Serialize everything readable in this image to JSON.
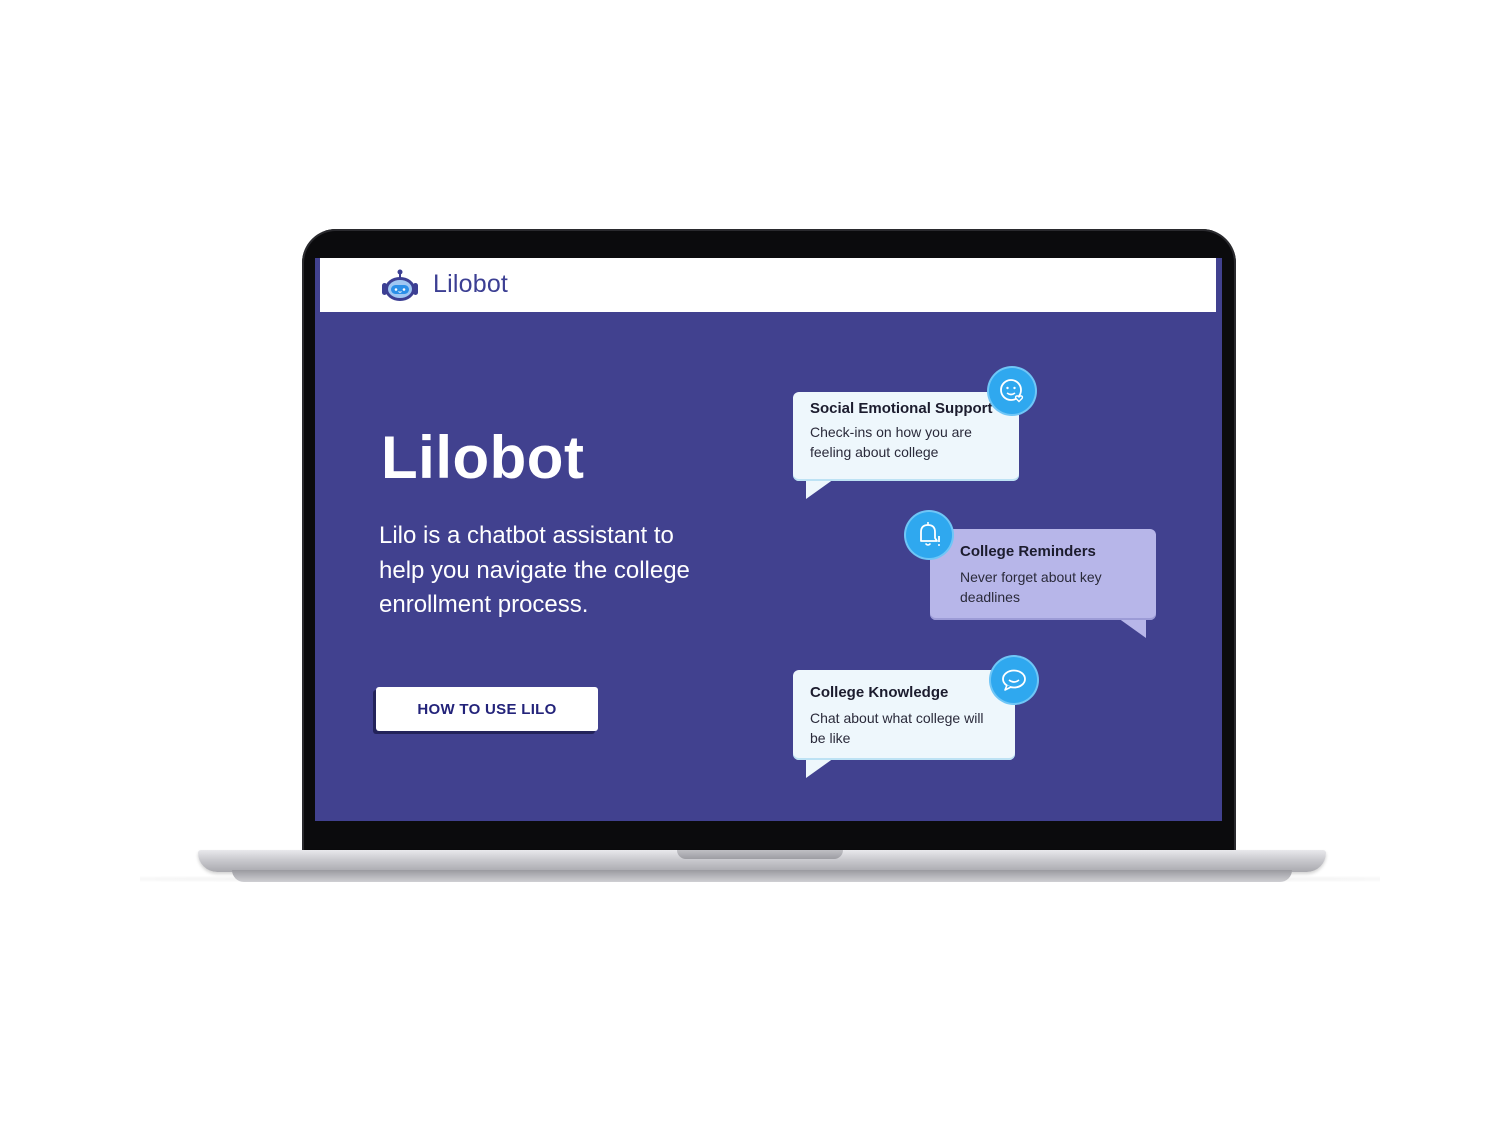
{
  "header": {
    "brand_name": "Lilobot",
    "logo_icon": "robot-icon"
  },
  "hero": {
    "title": "Lilobot",
    "description": "Lilo is a chatbot assistant to help you navigate the college enrollment process.",
    "cta_label": "HOW TO USE LILO"
  },
  "features": [
    {
      "title": "Social Emotional Support",
      "text": "Check-ins on how you are feeling about college",
      "icon": "smiley-heart-icon"
    },
    {
      "title": "College Reminders",
      "text": "Never forget about key deadlines",
      "icon": "bell-alert-icon"
    },
    {
      "title": "College Knowledge",
      "text": "Chat about what college will be like",
      "icon": "chat-bubble-icon"
    }
  ],
  "colors": {
    "screen_background": "#41418f",
    "brand_text": "#3c3f93",
    "bubble_light": "#eef7fc",
    "bubble_purple": "#b7b6e9",
    "icon_circle": "#2fa8ef",
    "cta_text": "#23237a"
  }
}
